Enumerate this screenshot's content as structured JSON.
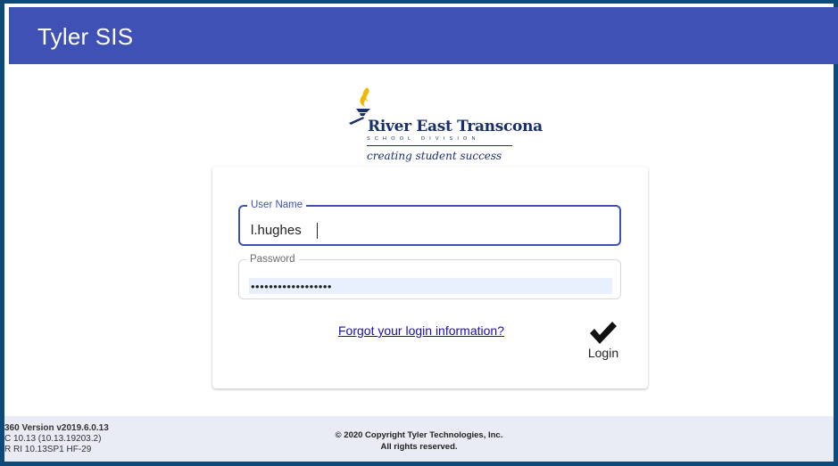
{
  "header": {
    "title": "Tyler SIS"
  },
  "logo": {
    "name": "River East Transcona",
    "subtitle": "SCHOOL DIVISION",
    "tagline": "creating student success"
  },
  "login": {
    "username_label": "User Name",
    "username_value": "l.hughes",
    "password_label": "Password",
    "password_value": "••••••••••••••••••",
    "forgot_link": "Forgot your login information?",
    "login_label": "Login"
  },
  "footer": {
    "version_line1": "360 Version v2019.6.0.13",
    "version_line2": "C 10.13 (10.13.19203.2)",
    "version_line3": "R RI 10.13SP1 HF-29",
    "copyright_line1": "© 2020 Copyright Tyler Technologies, Inc.",
    "copyright_line2": "All rights reserved."
  },
  "colors": {
    "header_bg": "#3f51b5",
    "frame_border": "#0d4a7a",
    "footer_bg": "#e9ebf5",
    "logo_blue": "#1a2e6b",
    "logo_gold": "#f2b705"
  },
  "icons": {
    "login": "checkmark-icon",
    "logo": "torch-icon"
  }
}
